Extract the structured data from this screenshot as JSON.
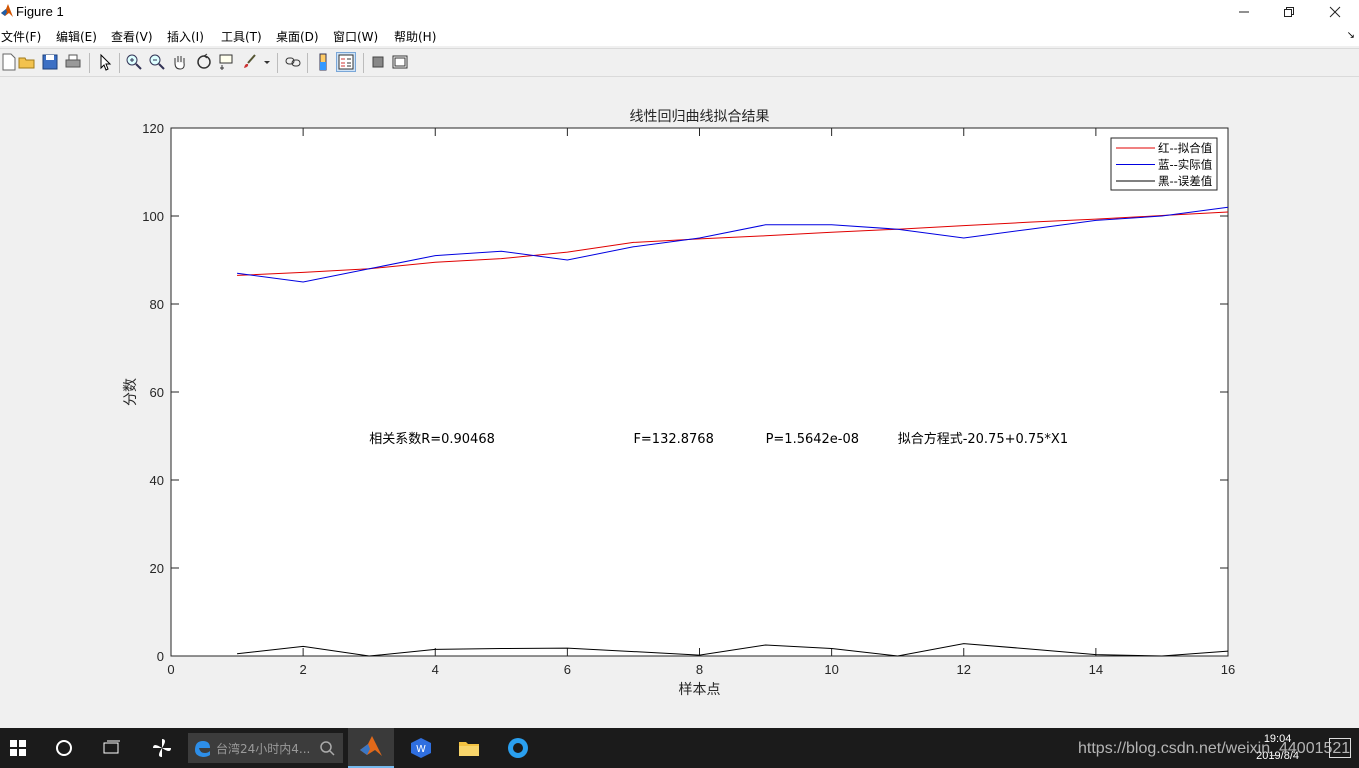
{
  "window": {
    "title": "Figure 1",
    "minimize_icon": "minimize-icon",
    "maximize_icon": "restore-icon",
    "close_icon": "close-icon"
  },
  "menu": [
    "文件(F)",
    "编辑(E)",
    "查看(V)",
    "插入(I)",
    "工具(T)",
    "桌面(D)",
    "窗口(W)",
    "帮助(H)"
  ],
  "toolbar": [
    "new-figure-icon",
    "open-icon",
    "save-icon",
    "print-icon",
    "select-arrow-icon",
    "zoom-in-icon",
    "zoom-out-icon",
    "pan-hand-icon",
    "rotate-3d-icon",
    "data-cursor-icon",
    "brush-icon",
    "link-plot-icon",
    "colorbar-icon",
    "legend-icon",
    "hide-plot-tools-icon",
    "show-plot-tools-icon"
  ],
  "chart_data": {
    "type": "line",
    "title": "线性回归曲线拟合结果",
    "xlabel": "样本点",
    "ylabel": "分数",
    "xlim": [
      0,
      16
    ],
    "ylim": [
      0,
      120
    ],
    "xticks": [
      0,
      2,
      4,
      6,
      8,
      10,
      12,
      14,
      16
    ],
    "yticks": [
      0,
      20,
      40,
      60,
      80,
      100,
      120
    ],
    "grid": false,
    "legend_position": "top-right",
    "x": [
      1,
      2,
      3,
      4,
      5,
      6,
      7,
      8,
      9,
      10,
      11,
      12,
      13,
      14,
      15,
      16
    ],
    "series": [
      {
        "name": "红--拟合值",
        "color": "#e00000",
        "values": [
          86.5,
          87.2,
          88.0,
          89.5,
          90.3,
          91.8,
          94.0,
          94.8,
          95.5,
          96.3,
          97.0,
          97.8,
          98.6,
          99.3,
          100.1,
          100.9
        ]
      },
      {
        "name": "蓝--实际值",
        "color": "#0000e0",
        "values": [
          87,
          85,
          88,
          91,
          92,
          90,
          93,
          95,
          98,
          98,
          97,
          95,
          97,
          99,
          100,
          102
        ]
      },
      {
        "name": "黑--误差值",
        "color": "#000000",
        "values": [
          0.5,
          2.2,
          0.0,
          1.5,
          1.7,
          1.8,
          1.0,
          0.2,
          2.5,
          1.7,
          0.0,
          2.8,
          1.6,
          0.3,
          0.0,
          1.1
        ]
      }
    ],
    "annotations": [
      {
        "text": "相关系数R=0.90468",
        "x": 3.0,
        "y": 49.5
      },
      {
        "text": "F=132.8768",
        "x": 7.0,
        "y": 49.5
      },
      {
        "text": "P=1.5642e-08",
        "x": 9.0,
        "y": 49.5
      },
      {
        "text": "拟合方程式-20.75+0.75*X1",
        "x": 11.0,
        "y": 49.5
      }
    ]
  },
  "taskbar": {
    "search_text": "台湾24小时内4...",
    "apps": [
      "windows-start-icon",
      "cortana-circle-icon",
      "task-view-icon",
      "pinwheel-app-icon",
      "edge-icon",
      "matlab-icon",
      "wps-icon",
      "file-explorer-icon",
      "browser-app-icon"
    ],
    "time": "19:04",
    "date": "2019/8/4"
  },
  "watermark": "https://blog.csdn.net/weixin_44001521"
}
